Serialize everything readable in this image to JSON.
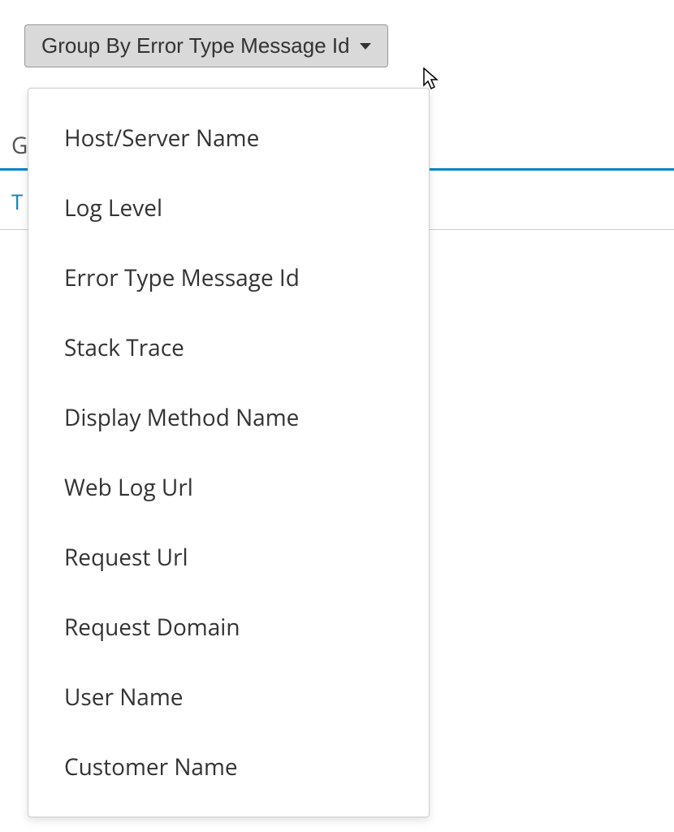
{
  "group_by_button": {
    "label": "Group By Error Type Message Id"
  },
  "background": {
    "row1_partial_text": "G",
    "row2_partial_text": "T"
  },
  "dropdown": {
    "items": [
      {
        "label": "Host/Server Name"
      },
      {
        "label": "Log Level"
      },
      {
        "label": "Error Type Message Id"
      },
      {
        "label": "Stack Trace"
      },
      {
        "label": "Display Method Name"
      },
      {
        "label": "Web Log Url"
      },
      {
        "label": "Request Url"
      },
      {
        "label": "Request Domain"
      },
      {
        "label": "User Name"
      },
      {
        "label": "Customer Name"
      }
    ]
  }
}
